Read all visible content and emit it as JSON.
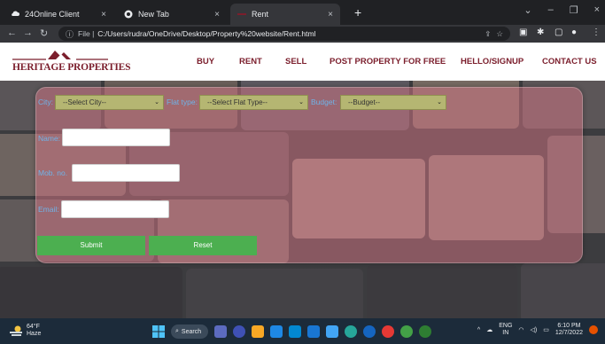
{
  "browser": {
    "tabs": [
      {
        "label": "24Online Client",
        "close": "×"
      },
      {
        "label": "New Tab",
        "close": "×"
      },
      {
        "label": "Rent",
        "close": "×"
      }
    ],
    "new_tab": "+",
    "window_controls": [
      "⌄",
      "–",
      "❐",
      "×"
    ],
    "url_prefix": "File |",
    "url": "C:/Users/rudra/OneDrive/Desktop/Property%20website/Rent.html"
  },
  "site": {
    "logo_text": "HERITAGE PROPERTIES",
    "nav": [
      "BUY",
      "RENT",
      "SELL",
      "POST PROPERTY FOR FREE",
      "HELLO/SIGNUP",
      "CONTACT US"
    ]
  },
  "form": {
    "city_label": "City:",
    "city_value": "--Select City--",
    "flat_label": "Flat type:",
    "flat_value": "--Select Flat Type--",
    "budget_label": "Budget:",
    "budget_value": "--Budget--",
    "name_label": "Name:",
    "mobile_label": "Mob. no.",
    "email_label": "Email:",
    "submit_label": "Submit",
    "reset_label": "Reset"
  },
  "taskbar": {
    "temp": "64°F",
    "weather": "Haze",
    "search_label": "Search",
    "lang_top": "ENG",
    "lang_bottom": "IN",
    "time": "6:10 PM",
    "date": "12/7/2022"
  },
  "colors": {
    "brand": "#7b1e2c",
    "label_blue": "#6fb3e8",
    "select_olive": "#b5b672",
    "button_green": "#4caf50"
  }
}
